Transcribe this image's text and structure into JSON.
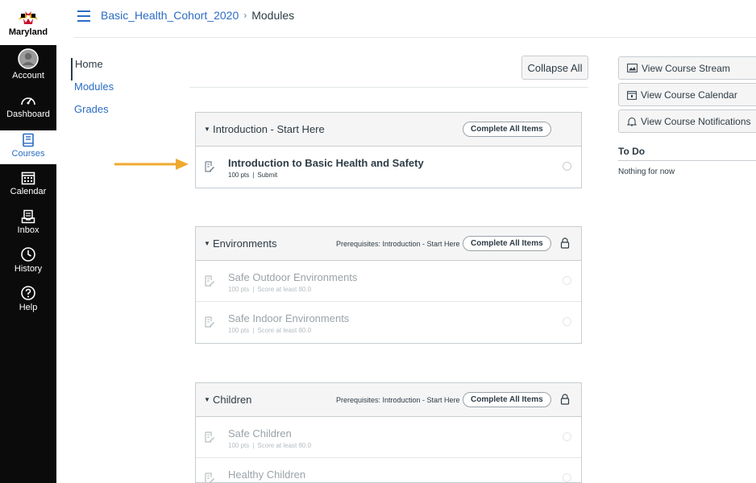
{
  "global_nav": {
    "logo_text": "Maryland",
    "items": [
      {
        "label": "Account",
        "icon": "account-icon"
      },
      {
        "label": "Dashboard",
        "icon": "dashboard-icon"
      },
      {
        "label": "Courses",
        "icon": "courses-icon",
        "active": true
      },
      {
        "label": "Calendar",
        "icon": "calendar-icon"
      },
      {
        "label": "Inbox",
        "icon": "inbox-icon"
      },
      {
        "label": "History",
        "icon": "history-icon"
      },
      {
        "label": "Help",
        "icon": "help-icon"
      }
    ]
  },
  "breadcrumb": {
    "course": "Basic_Health_Cohort_2020",
    "separator": "›",
    "current": "Modules"
  },
  "course_nav": {
    "items": [
      {
        "label": "Home",
        "active": true
      },
      {
        "label": "Modules"
      },
      {
        "label": "Grades"
      }
    ]
  },
  "main": {
    "collapse_all_label": "Collapse All",
    "modules": [
      {
        "title": "Introduction - Start Here",
        "prerequisites": "",
        "complete_label": "Complete All Items",
        "locked": false,
        "items": [
          {
            "title": "Introduction to Basic Health and Safety",
            "points": "100 pts",
            "separator": "|",
            "requirement": "Submit"
          }
        ]
      },
      {
        "title": "Environments",
        "prerequisites": "Prerequisites: Introduction - Start Here",
        "complete_label": "Complete All Items",
        "locked": true,
        "items": [
          {
            "title": "Safe Outdoor Environments",
            "points": "100 pts",
            "separator": "|",
            "requirement": "Score at least 80.0"
          },
          {
            "title": "Safe Indoor Environments",
            "points": "100 pts",
            "separator": "|",
            "requirement": "Score at least 80.0"
          }
        ]
      },
      {
        "title": "Children",
        "prerequisites": "Prerequisites: Introduction - Start Here",
        "complete_label": "Complete All Items",
        "locked": true,
        "items": [
          {
            "title": "Safe Children",
            "points": "100 pts",
            "separator": "|",
            "requirement": "Score at least 80.0"
          },
          {
            "title": "Healthy Children"
          }
        ]
      }
    ]
  },
  "sidebar": {
    "buttons": [
      {
        "label": "View Course Stream",
        "icon": "stream-icon"
      },
      {
        "label": "View Course Calendar",
        "icon": "calendar-icon"
      },
      {
        "label": "View Course Notifications",
        "icon": "bell-icon"
      }
    ],
    "todo_title": "To Do",
    "todo_empty": "Nothing for now"
  },
  "colors": {
    "link": "#2b6cc4",
    "nav_bg": "#0b0b0b",
    "arrow": "#f0a92e",
    "text": "#2d3b45"
  }
}
